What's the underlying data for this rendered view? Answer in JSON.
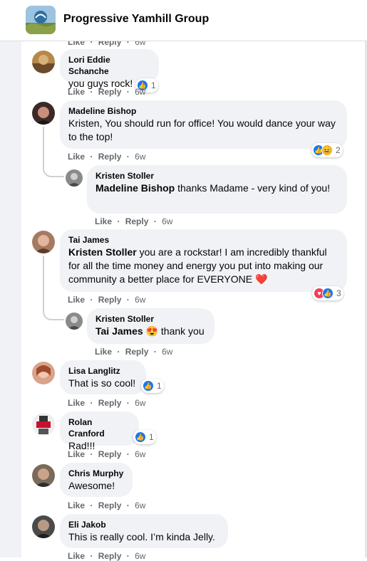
{
  "header": {
    "group_name": "Progressive Yamhill Group"
  },
  "actions": {
    "like": "Like",
    "reply": "Reply",
    "dot": "·"
  },
  "top_partial": {
    "time": "6w"
  },
  "comments": [
    {
      "author": "Lori Eddie Schanche",
      "text": "you guys rock!",
      "time": "6w",
      "reaction_count": "1",
      "reactions": [
        "like"
      ]
    },
    {
      "author": "Madeline Bishop",
      "text": "Kristen, You should run for office! You would dance your way to the top!",
      "time": "6w",
      "reaction_count": "2",
      "reactions": [
        "like",
        "haha"
      ]
    },
    {
      "author": "Kristen Stoller",
      "mention": "Madeline Bishop",
      "text": " thanks Madame - very kind of you!",
      "time": "6w"
    },
    {
      "author": "Tai James",
      "mention": "Kristen Stoller",
      "text": " you are a rockstar! I am incredibly thankful for all the time money and energy you put into making our community a better place for EVERYONE",
      "emoji": "❤️",
      "time": "6w",
      "reaction_count": "3",
      "reactions": [
        "love",
        "like"
      ]
    },
    {
      "author": "Kristen Stoller",
      "mention": "Tai James",
      "emoji": "😍",
      "text": " thank you",
      "time": "6w"
    },
    {
      "author": "Lisa Langlitz",
      "text": "That is so cool!",
      "time": "6w",
      "reaction_count": "1",
      "reactions": [
        "like"
      ]
    },
    {
      "author": "Rolan Cranford",
      "text": "Rad!!!",
      "time": "6w",
      "reaction_count": "1",
      "reactions": [
        "like"
      ]
    },
    {
      "author": "Chris Murphy",
      "text": "Awesome!",
      "time": "6w"
    },
    {
      "author": "Eli Jakob",
      "text": "This is really cool. I’m kinda Jelly.",
      "time": "6w"
    }
  ],
  "icons": {
    "like": "thumbs-up-icon",
    "love": "heart-icon",
    "haha": "laughing-face-icon"
  },
  "colors": {
    "bubble": "#f0f2f5",
    "meta": "#65676b",
    "like_blue": "#1877f2",
    "love_red": "#f33e58"
  }
}
